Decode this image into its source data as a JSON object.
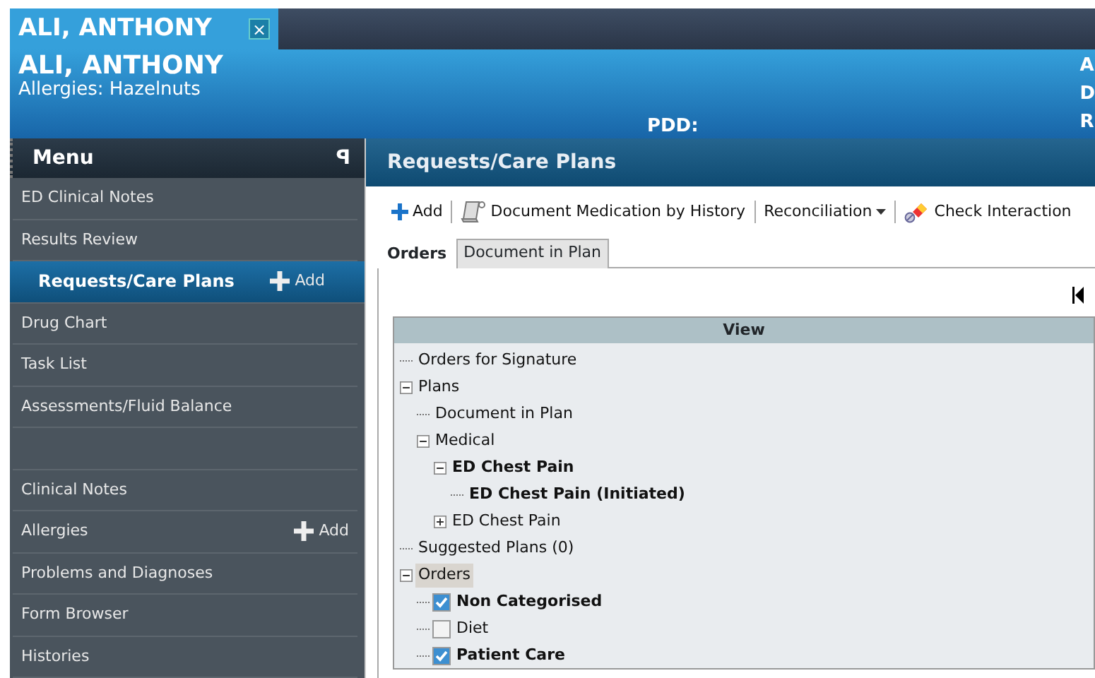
{
  "patient_tab": {
    "label": "ALI, ANTHONY",
    "close": "×"
  },
  "banner": {
    "name": "ALI, ANTHONY",
    "allergies": "Allergies: Hazelnuts",
    "pdd": "PDD:",
    "right_edge": [
      "A",
      "D",
      "R"
    ]
  },
  "menu": {
    "title": "Menu",
    "pin": "ꟼ",
    "items": [
      {
        "kind": "link",
        "label": "ED Clinical Notes",
        "selected": false
      },
      {
        "kind": "link",
        "label": "Results Review",
        "selected": false
      },
      {
        "kind": "link",
        "label": "Requests/Care Plans",
        "selected": true,
        "add": "Add"
      },
      {
        "kind": "link",
        "label": "Drug Chart",
        "selected": false
      },
      {
        "kind": "link",
        "label": "Task List",
        "selected": false
      },
      {
        "kind": "link",
        "label": "Assessments/Fluid Balance",
        "selected": false
      },
      {
        "kind": "spacer"
      },
      {
        "kind": "link",
        "label": "Clinical Notes",
        "selected": false
      },
      {
        "kind": "link",
        "label": "Allergies",
        "selected": false,
        "add": "Add"
      },
      {
        "kind": "link",
        "label": "Problems and Diagnoses",
        "selected": false
      },
      {
        "kind": "link",
        "label": "Form Browser",
        "selected": false
      },
      {
        "kind": "link",
        "label": "Histories",
        "selected": false
      }
    ]
  },
  "content": {
    "title": "Requests/Care Plans",
    "toolbar": [
      {
        "kind": "add",
        "label": "Add"
      },
      {
        "kind": "document",
        "label": "Document Medication by History"
      },
      {
        "kind": "dropdown",
        "label": "Reconciliation"
      },
      {
        "kind": "interactions",
        "label": "Check Interaction"
      }
    ],
    "tabs": [
      {
        "label": "Orders",
        "selected": true
      },
      {
        "label": "Document in Plan",
        "selected": false
      }
    ],
    "view_header": "View",
    "tree": [
      {
        "kind": "node",
        "label": "Orders for Signature",
        "bold": false,
        "selected": false
      },
      {
        "kind": "node",
        "label": "Plans",
        "bold": false,
        "selected": false,
        "expanded": true,
        "children": [
          {
            "kind": "node",
            "label": "Document in Plan",
            "bold": false,
            "selected": false
          },
          {
            "kind": "node",
            "label": "Medical",
            "bold": false,
            "selected": false,
            "expanded": true,
            "children": [
              {
                "kind": "node",
                "label": "ED Chest Pain",
                "bold": true,
                "selected": false,
                "expanded": true,
                "children": [
                  {
                    "kind": "node",
                    "label": "ED Chest Pain (Initiated)",
                    "bold": true,
                    "selected": false
                  }
                ]
              },
              {
                "kind": "node",
                "label": "ED Chest Pain",
                "bold": false,
                "selected": false,
                "expanded": false
              }
            ]
          }
        ]
      },
      {
        "kind": "node",
        "label": "Suggested Plans (0)",
        "bold": false,
        "selected": false
      },
      {
        "kind": "node",
        "label": "Orders",
        "bold": false,
        "selected": true,
        "expanded": true,
        "children": [
          {
            "kind": "checkbox",
            "label": "Non Categorised",
            "bold": true,
            "selected": false,
            "checked": true
          },
          {
            "kind": "checkbox",
            "label": "Diet",
            "bold": false,
            "selected": false,
            "checked": false
          },
          {
            "kind": "checkbox",
            "label": "Patient Care",
            "bold": true,
            "selected": false,
            "checked": true
          }
        ]
      }
    ]
  }
}
